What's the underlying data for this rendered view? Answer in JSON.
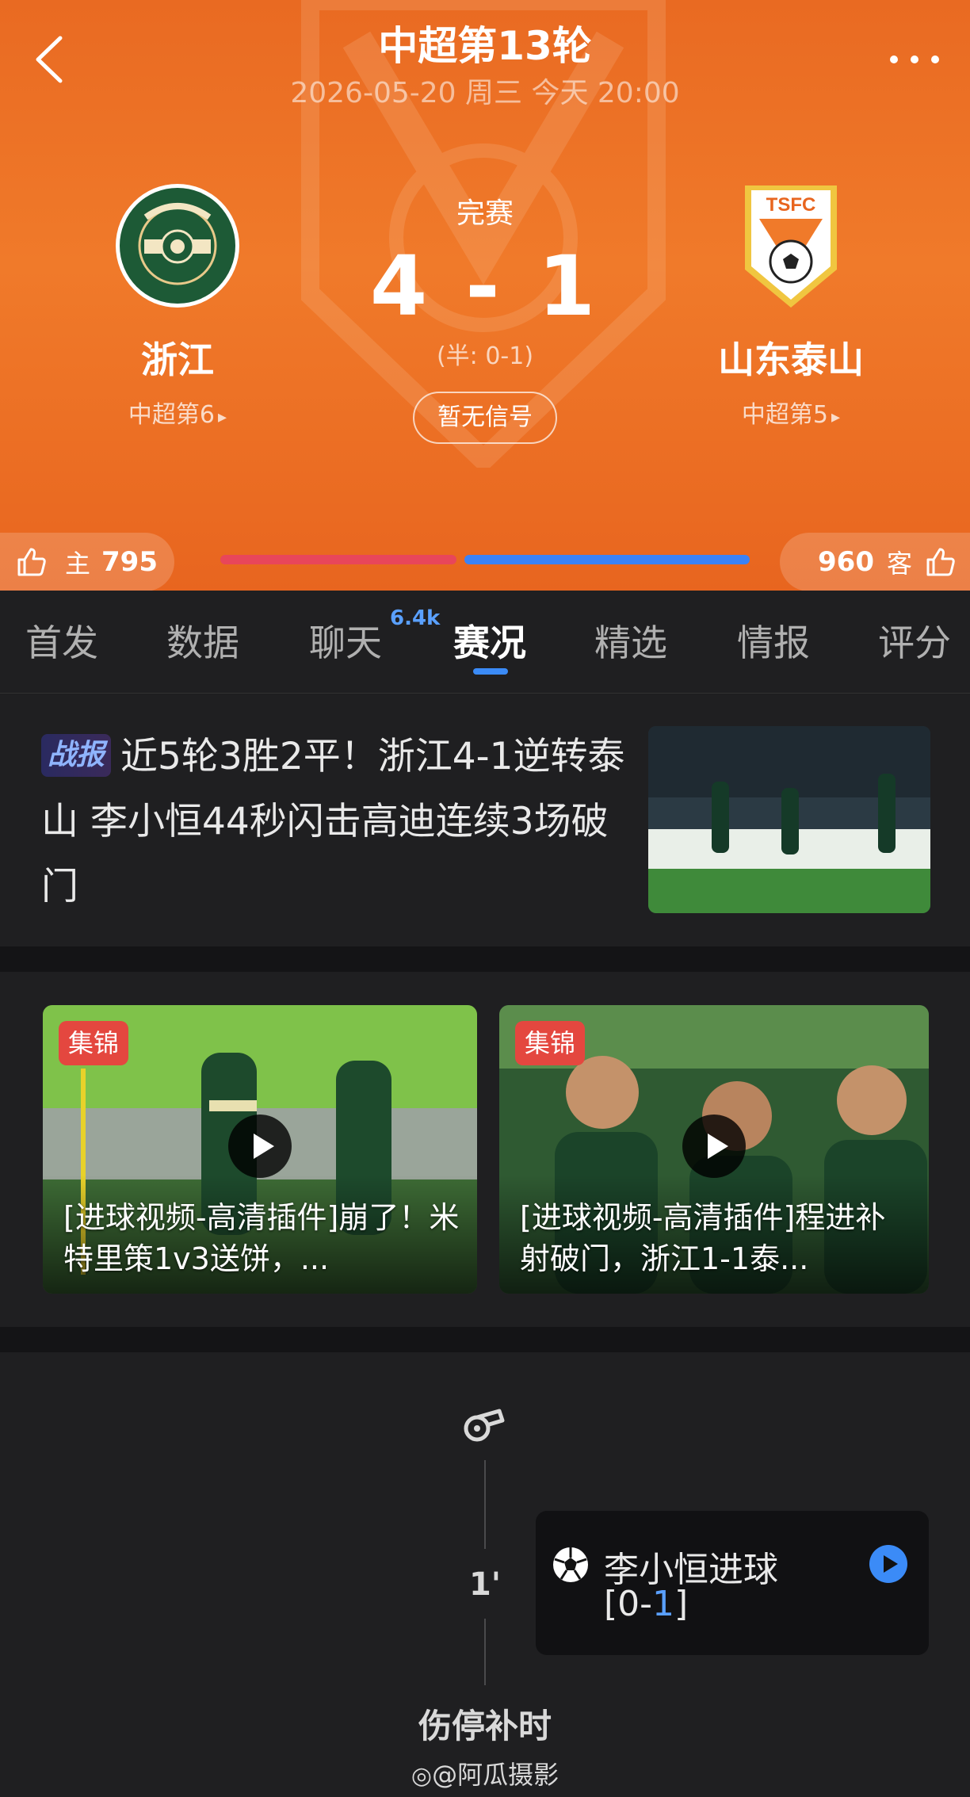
{
  "header": {
    "title": "中超第13轮",
    "datetime": "2026-05-20 周三 今天 20:00",
    "status": "完赛",
    "score": "4 - 1",
    "halftime": "(半: 0-1)",
    "signal_button": "暂无信号",
    "home": {
      "name": "浙江",
      "rank": "中超第6",
      "logo_icon": "zhejiang-fc-logo"
    },
    "away": {
      "name": "山东泰山",
      "rank": "中超第5",
      "logo_icon": "tsfc-logo"
    },
    "colors": {
      "header_bg": "#ec6e24",
      "home_bar": "#e8465a",
      "away_bar": "#3b82f6"
    }
  },
  "vote": {
    "home_label": "主",
    "home_count": "795",
    "away_label": "客",
    "away_count": "960",
    "home_share": 0.453,
    "away_share": 0.547
  },
  "tabs": [
    {
      "label": "首发"
    },
    {
      "label": "数据"
    },
    {
      "label": "聊天",
      "badge": "6.4k"
    },
    {
      "label": "赛况",
      "active": true
    },
    {
      "label": "精选"
    },
    {
      "label": "情报"
    },
    {
      "label": "评分"
    }
  ],
  "news": {
    "tag": "战报",
    "headline": "近5轮3胜2平！浙江4-1逆转泰山 李小恒44秒闪击高迪连续3场破门"
  },
  "videos": [
    {
      "tag": "集锦",
      "title": "[进球视频-高清插件]崩了！米特里策1v3送饼，..."
    },
    {
      "tag": "集锦",
      "title": "[进球视频-高清插件]程进补射破门，浙江1-1泰..."
    }
  ],
  "timeline": {
    "minute": "1'",
    "event_title": "李小恒进球",
    "event_score_open": "[0-",
    "event_score_highlight": "1",
    "event_score_close": "]",
    "stoppage_label": "伤停补时"
  },
  "watermark": "@阿瓜摄影"
}
